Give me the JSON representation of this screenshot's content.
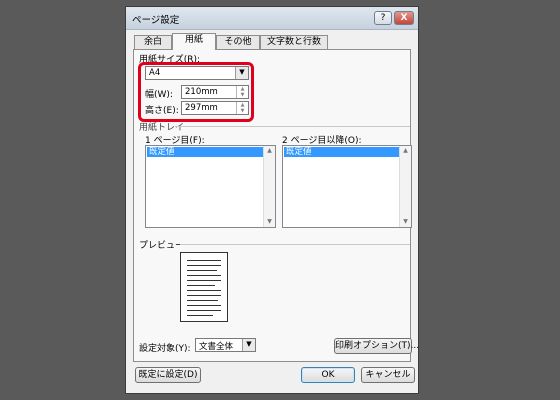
{
  "dialog": {
    "title": "ページ設定",
    "help_label": "?",
    "close_label": "X"
  },
  "tabs": [
    {
      "label": "余白"
    },
    {
      "label": "用紙",
      "active": true
    },
    {
      "label": "その他"
    },
    {
      "label": "文字数と行数"
    }
  ],
  "paper_size": {
    "group_label": "用紙サイズ(R):",
    "selected": "A4",
    "width_label": "幅(W):",
    "width_value": "210mm",
    "height_label": "高さ(E):",
    "height_value": "297mm"
  },
  "paper_tray": {
    "group_label": "用紙トレイ",
    "first_page_label": "1 ページ目(F):",
    "first_page_selected": "既定値",
    "other_pages_label": "2 ページ目以降(O):",
    "other_pages_selected": "既定値"
  },
  "preview": {
    "group_label": "プレビュー"
  },
  "apply_to": {
    "label": "設定対象(Y):",
    "selected": "文書全体"
  },
  "buttons": {
    "print_options": "印刷オプション(T)...",
    "set_default": "既定に設定(D)",
    "ok": "OK",
    "cancel": "キャンセル"
  },
  "colors": {
    "highlight_box": "#e0001b",
    "selection": "#3399ff",
    "backdrop": "#5a5a5a"
  }
}
